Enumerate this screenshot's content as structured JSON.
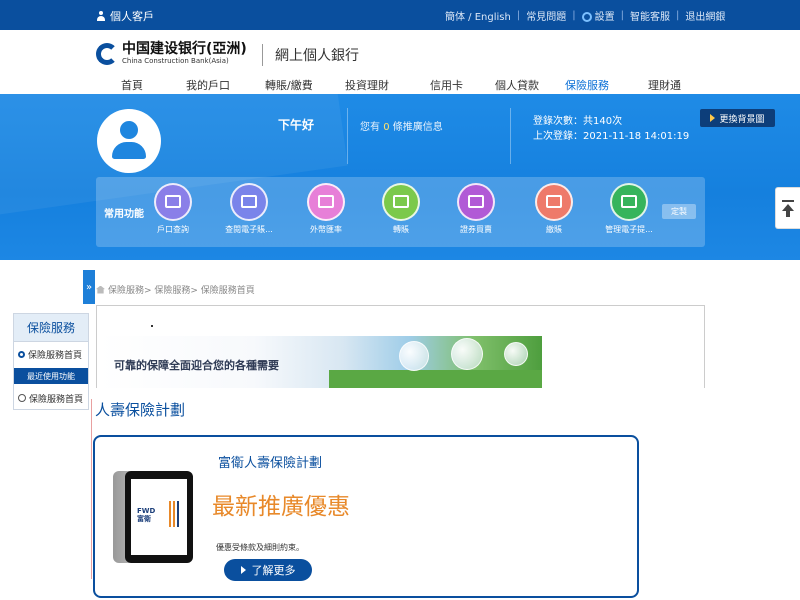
{
  "topbar": {
    "personal": "個人客戶",
    "links": [
      "簡体 / English",
      "常見問題",
      "設置",
      "智能客服",
      "退出網銀"
    ]
  },
  "header": {
    "logo_cn": "中国建设银行(亞洲)",
    "logo_en": "China Construction Bank(Asia)",
    "subtitle": "網上個人銀行"
  },
  "nav": [
    {
      "label": "首頁"
    },
    {
      "label": "我的戶口"
    },
    {
      "label": "轉賬/繳費"
    },
    {
      "label": "投資理財"
    },
    {
      "label": "信用卡"
    },
    {
      "label": "個人貸款"
    },
    {
      "label": "保險服務",
      "active": true
    },
    {
      "label": "理財通"
    }
  ],
  "banner": {
    "greeting": "下午好",
    "msg_prefix": "您有",
    "msg_count": "0",
    "msg_suffix": "條推廣信息",
    "login_count": "登錄次數：共140次",
    "last_login": "上次登錄：2021-11-18 14:01:19",
    "change_bg": "更換背景圖"
  },
  "shortcuts": {
    "label": "常用功能",
    "customize": "定製",
    "items": [
      {
        "label": "戶口查詢",
        "color": "#8a7fe8"
      },
      {
        "label": "查閱電子賬...",
        "color": "#7a84ea"
      },
      {
        "label": "外幣匯率",
        "color": "#e77fd8"
      },
      {
        "label": "轉賬",
        "color": "#7bc94b"
      },
      {
        "label": "證券買賣",
        "color": "#b15ad6"
      },
      {
        "label": "繳賬",
        "color": "#ee7a6a"
      },
      {
        "label": "管理電子提...",
        "color": "#36b45c"
      }
    ]
  },
  "breadcrumb": "保險服務> 保險服務> 保險服務首頁",
  "sidemenu": {
    "title": "保險服務",
    "home": "保險服務首頁",
    "recent": "最近使用功能",
    "recent_item": "保險服務首頁"
  },
  "ins_banner": "可靠的保障全面迎合您的各種需要",
  "section_title": "人壽保險計劃",
  "promo": {
    "fwd": "FWD",
    "fwd_cn": "富衛",
    "title": "富衛人壽保險計劃",
    "headline": "最新推廣優惠",
    "note": "優惠受條款及細則約束。",
    "more": "了解更多"
  }
}
